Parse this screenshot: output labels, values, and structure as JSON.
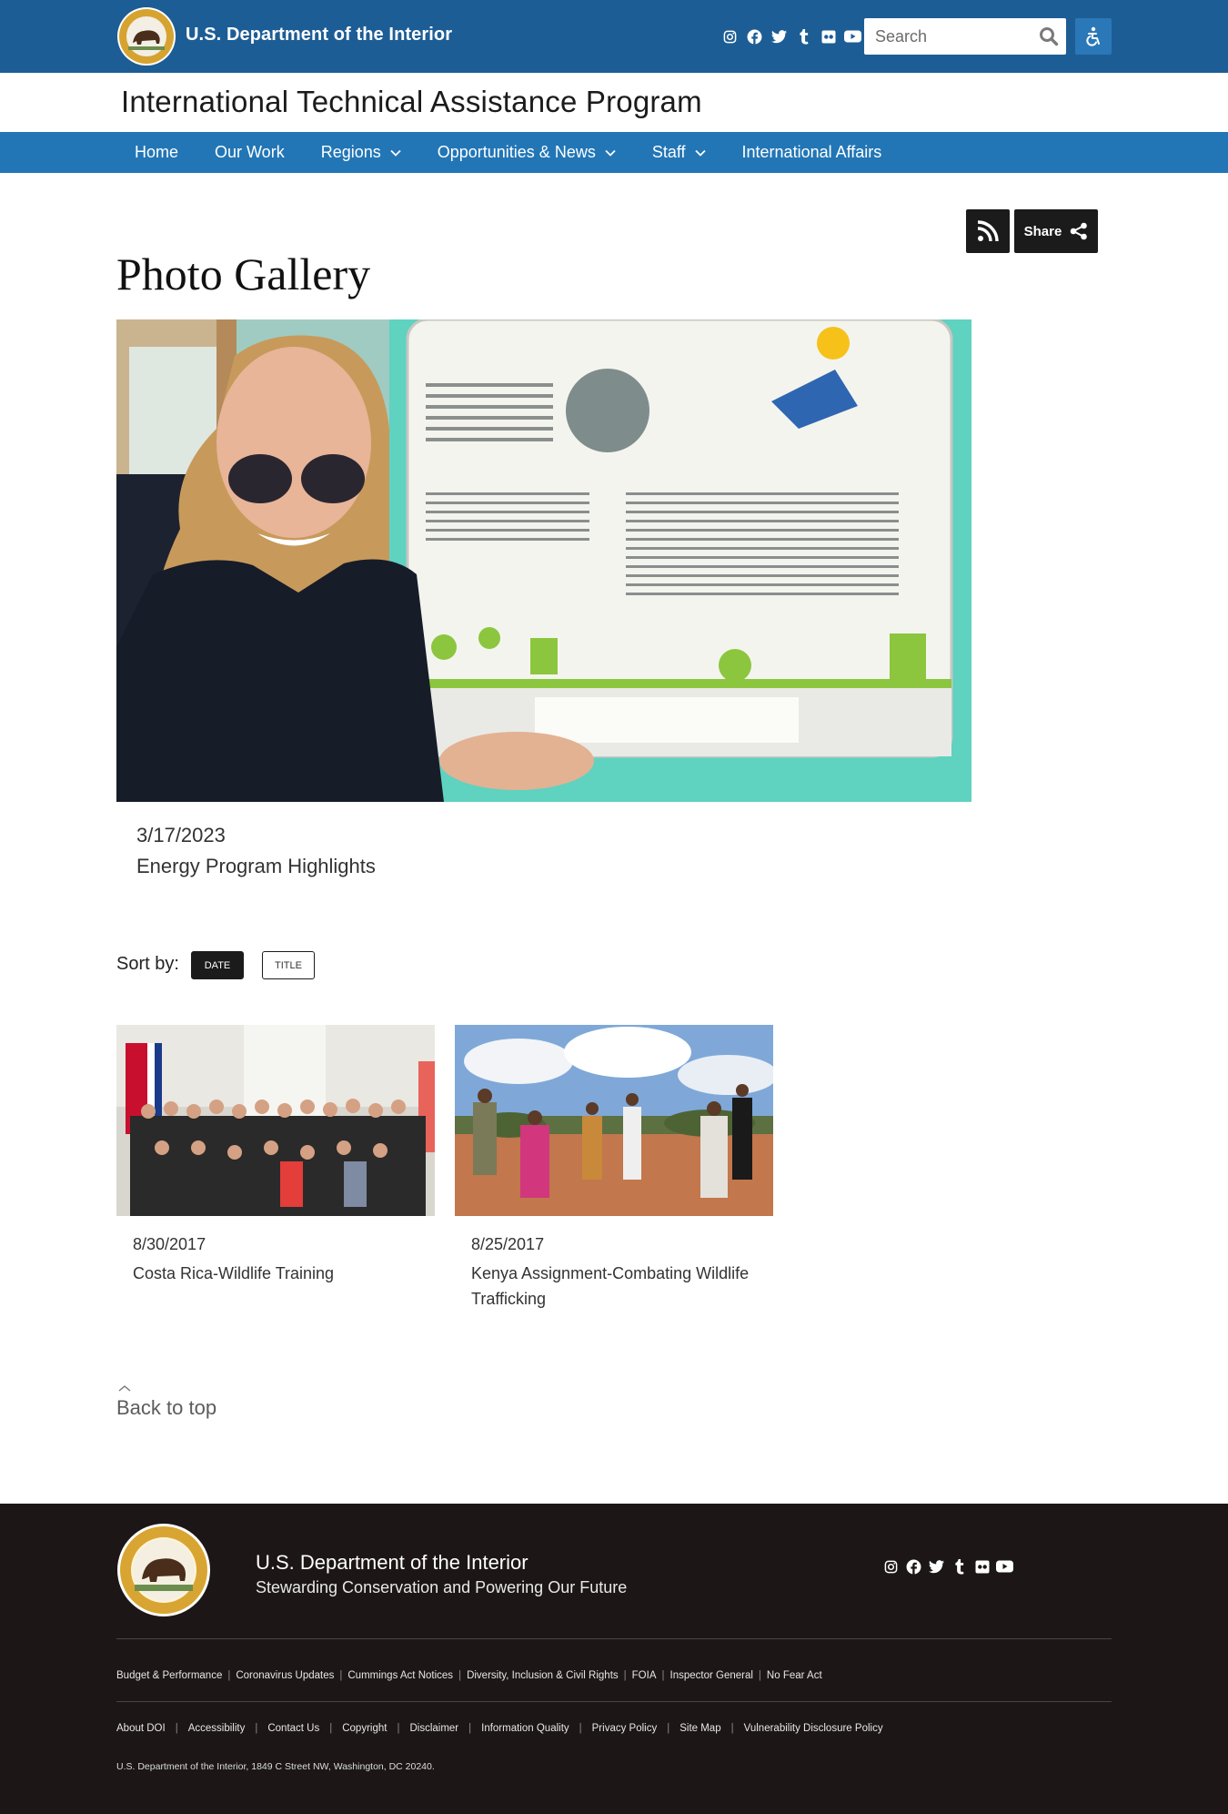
{
  "header": {
    "agency": "U.S. Department of the Interior",
    "search_placeholder": "Search",
    "social_icons": [
      "instagram-icon",
      "facebook-icon",
      "twitter-icon",
      "tumblr-icon",
      "flickr-icon",
      "youtube-icon"
    ],
    "brand_color": "#1d5d95",
    "nav_color": "#2276b6"
  },
  "site_title": "International Technical Assistance Program",
  "nav": {
    "items": [
      {
        "label": "Home",
        "has_dropdown": false
      },
      {
        "label": "Our Work",
        "has_dropdown": false
      },
      {
        "label": "Regions",
        "has_dropdown": true
      },
      {
        "label": "Opportunities & News",
        "has_dropdown": true
      },
      {
        "label": "Staff",
        "has_dropdown": true
      },
      {
        "label": "International Affairs",
        "has_dropdown": false
      }
    ]
  },
  "actions": {
    "share_label": "Share"
  },
  "page": {
    "title": "Photo Gallery"
  },
  "featured": {
    "date": "3/17/2023",
    "title": "Energy Program Highlights"
  },
  "sort": {
    "label": "Sort by:",
    "options": [
      "DATE",
      "TITLE"
    ],
    "selected": "DATE"
  },
  "gallery": [
    {
      "date": "8/30/2017",
      "title": "Costa Rica-Wildlife Training"
    },
    {
      "date": "8/25/2017",
      "title": "Kenya Assignment-Combating Wildlife Trafficking"
    }
  ],
  "back_to_top": "Back to top",
  "footer": {
    "org": "U.S. Department of the Interior",
    "tagline": "Stewarding Conservation and Powering Our Future",
    "links_row1": [
      "Budget & Performance",
      "Coronavirus Updates",
      "Cummings Act Notices",
      "Diversity, Inclusion & Civil Rights",
      "FOIA",
      "Inspector General",
      "No Fear Act"
    ],
    "links_row2": [
      "About DOI",
      "Accessibility",
      "Contact Us",
      "Copyright",
      "Disclaimer",
      "Information Quality",
      "Privacy Policy",
      "Site Map",
      "Vulnerability Disclosure Policy"
    ],
    "address": "U.S. Department of the Interior, 1849 C Street NW, Washington, DC 20240.",
    "background_color": "#1c1716"
  }
}
